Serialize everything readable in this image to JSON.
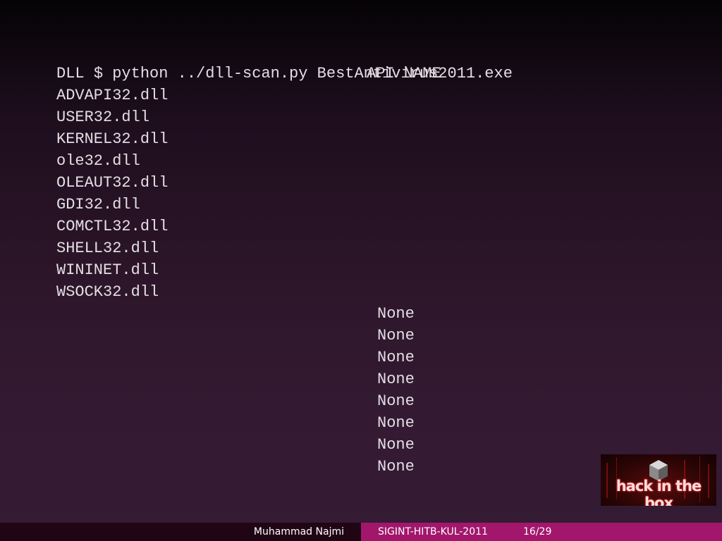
{
  "terminal": {
    "command": "$ python ../dll-scan.py BestAntivirus2011.exe",
    "headers": {
      "dll": "DLL",
      "api": "API NAME"
    },
    "dlls": [
      "ADVAPI32.dll",
      "USER32.dll",
      "KERNEL32.dll",
      "ole32.dll",
      "OLEAUT32.dll",
      "GDI32.dll",
      "COMCTL32.dll",
      "SHELL32.dll",
      "WININET.dll",
      "WSOCK32.dll"
    ],
    "api_values": [
      "None",
      "None",
      "None",
      "None",
      "None",
      "None",
      "None",
      "None"
    ]
  },
  "logo": {
    "text": "hack in the box",
    "icon": "cube-icon"
  },
  "footer": {
    "author": "Muhammad Najmi",
    "event": "SIGINT-HITB-KUL-2011",
    "page": "16/29"
  },
  "colors": {
    "footer_left": "#200615",
    "footer_right": "#a2176c",
    "text": "#e4dee4"
  }
}
